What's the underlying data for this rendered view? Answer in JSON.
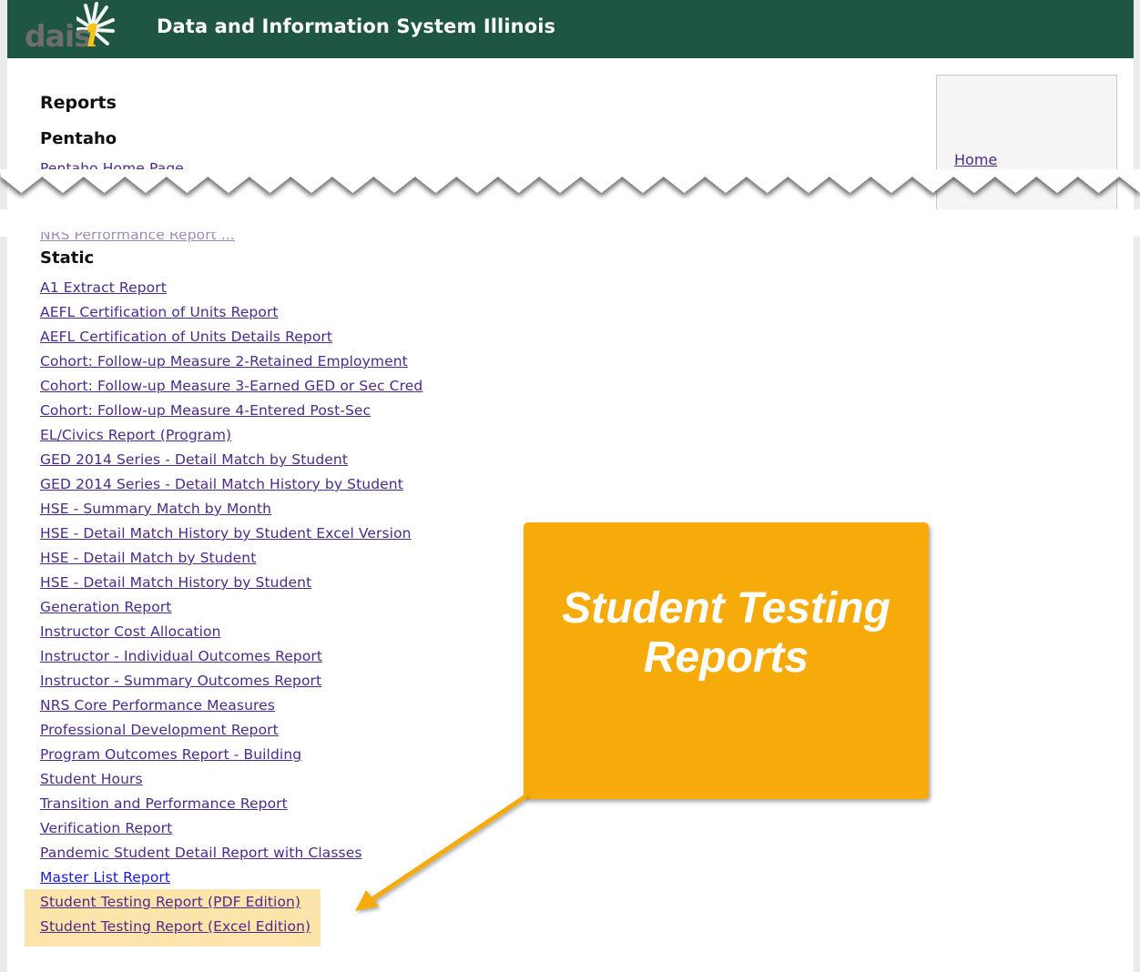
{
  "header": {
    "logo_text": "dais",
    "logo_i": "i",
    "title": "Data and Information System Illinois"
  },
  "sidebar": {
    "items": [
      {
        "label": "Home"
      }
    ]
  },
  "main": {
    "title": "Reports",
    "sections": [
      {
        "heading": "Pentaho",
        "links": [
          "Pentaho Home Page"
        ]
      },
      {
        "heading": "Static",
        "links": [
          "A1 Extract Report",
          "AEFL Certification of Units Report",
          "AEFL Certification of Units Details Report",
          "Cohort: Follow-up Measure 2-Retained Employment",
          "Cohort: Follow-up Measure 3-Earned GED or Sec Cred",
          "Cohort: Follow-up Measure 4-Entered Post-Sec",
          "EL/Civics Report (Program)",
          "GED 2014 Series - Detail Match by Student",
          "GED 2014 Series - Detail Match History by Student",
          "HSE - Summary Match by Month",
          "HSE - Detail Match History by Student Excel Version",
          "HSE - Detail Match by Student",
          "HSE - Detail Match History by Student",
          "Generation Report",
          "Instructor Cost Allocation",
          "Instructor - Individual Outcomes Report",
          "Instructor - Summary Outcomes Report",
          "NRS Core Performance Measures",
          "Professional Development Report",
          "Program Outcomes Report - Building",
          "Student Hours",
          "Transition and Performance Report",
          "Verification Report",
          "Pandemic Student Detail Report with Classes",
          "Master List Report",
          "Student Testing Report (PDF Edition)",
          "Student Testing Report (Excel Edition)"
        ]
      }
    ],
    "truncated_link": "NRS Performance Report ..."
  },
  "annotation": {
    "callout_line1": "Student Testing",
    "callout_line2": "Reports",
    "callout_color": "#f6ab0b",
    "highlight_color": "#fce4aa"
  }
}
